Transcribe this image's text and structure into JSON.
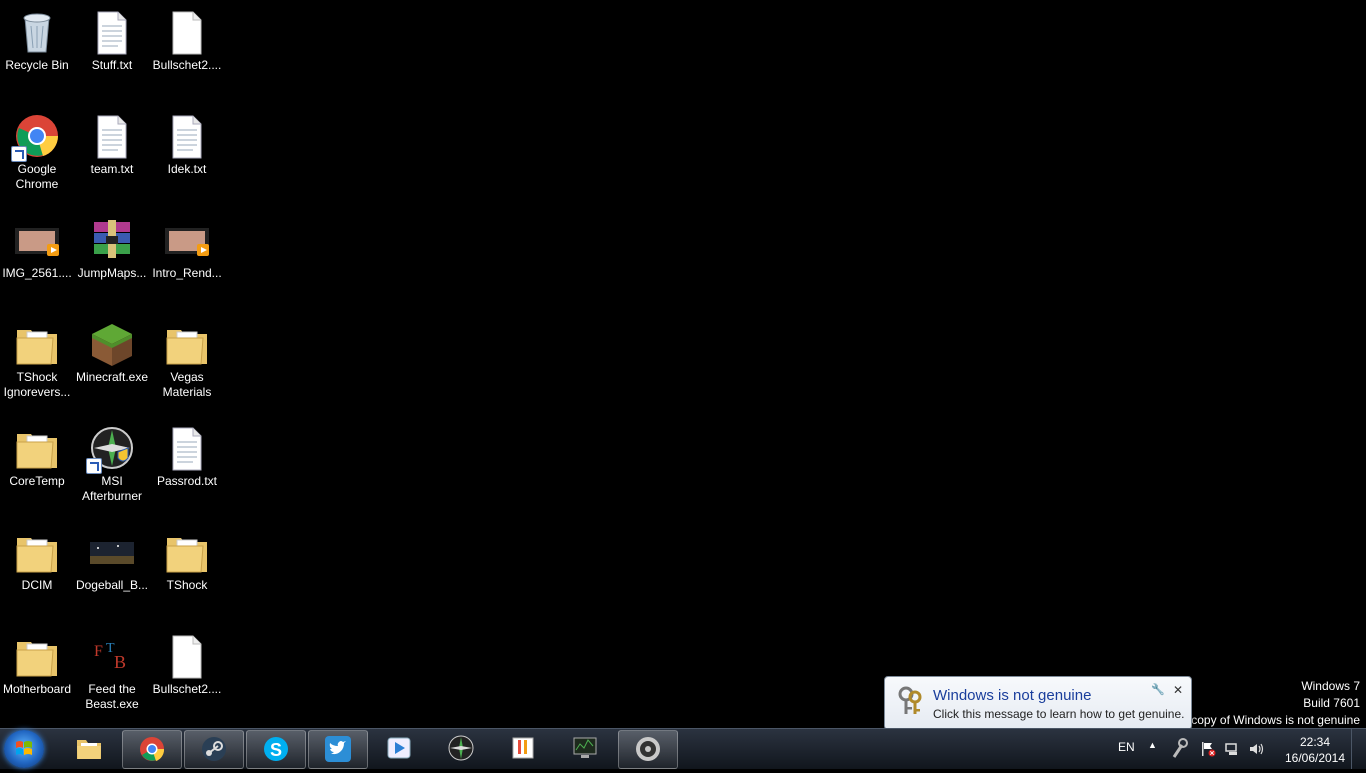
{
  "desktop": {
    "icons": [
      {
        "label": "Recycle Bin",
        "icon": "recycle-bin-icon"
      },
      {
        "label": "Stuff.txt",
        "icon": "text-file-icon"
      },
      {
        "label": "Bullschet2....",
        "icon": "blank-file-icon"
      },
      {
        "label": "Google Chrome",
        "icon": "chrome-icon"
      },
      {
        "label": "team.txt",
        "icon": "text-file-icon"
      },
      {
        "label": "Idek.txt",
        "icon": "text-file-icon"
      },
      {
        "label": "IMG_2561....",
        "icon": "video-file-icon"
      },
      {
        "label": "JumpMaps...",
        "icon": "winrar-archive-icon"
      },
      {
        "label": "Intro_Rend...",
        "icon": "video-file-icon"
      },
      {
        "label": "TShock Ignorevers...",
        "icon": "folder-icon"
      },
      {
        "label": "Minecraft.exe",
        "icon": "minecraft-grass-block-icon"
      },
      {
        "label": "Vegas Materials",
        "icon": "folder-icon"
      },
      {
        "label": "CoreTemp",
        "icon": "folder-icon"
      },
      {
        "label": "MSI Afterburner",
        "icon": "msi-afterburner-icon"
      },
      {
        "label": "Passrod.txt",
        "icon": "text-file-icon"
      },
      {
        "label": "DCIM",
        "icon": "folder-icon"
      },
      {
        "label": "Dogeball_B...",
        "icon": "image-file-icon"
      },
      {
        "label": "TShock",
        "icon": "folder-icon"
      },
      {
        "label": "Motherboard",
        "icon": "folder-icon"
      },
      {
        "label": "Feed the Beast.exe",
        "icon": "ftb-icon"
      },
      {
        "label": "Bullschet2....",
        "icon": "blank-file-icon"
      }
    ]
  },
  "watermark": {
    "line1": "Windows 7",
    "line2": "Build 7601",
    "line3": "This copy of Windows is not genuine"
  },
  "balloon": {
    "title": "Windows is not genuine",
    "text": "Click this message to learn how to get genuine.",
    "close": "✕",
    "options": "🔧"
  },
  "taskbar": {
    "start_icon": "windows-start-orb-icon",
    "pinned": [
      {
        "name": "explorer",
        "icon": "folder-library-icon",
        "active": false
      },
      {
        "name": "chrome",
        "icon": "chrome-icon",
        "active": true
      },
      {
        "name": "steam",
        "icon": "steam-icon",
        "active": true
      },
      {
        "name": "skype",
        "icon": "skype-icon",
        "active": true
      },
      {
        "name": "twitter",
        "icon": "twitter-icon",
        "active": true
      },
      {
        "name": "media-player",
        "icon": "play-icon",
        "active": false
      },
      {
        "name": "msi-afterburner",
        "icon": "msi-afterburner-icon",
        "active": false
      },
      {
        "name": "coretemp",
        "icon": "thermometer-icon",
        "active": false
      },
      {
        "name": "monitor",
        "icon": "system-monitor-icon",
        "active": false
      },
      {
        "name": "source-game",
        "icon": "game-icon",
        "active": true
      }
    ],
    "tray": {
      "language": "EN",
      "time": "22:34",
      "date": "16/06/2014"
    }
  },
  "colors": {
    "desktop_bg": "#000000",
    "balloon_title": "#1a3e9c"
  }
}
